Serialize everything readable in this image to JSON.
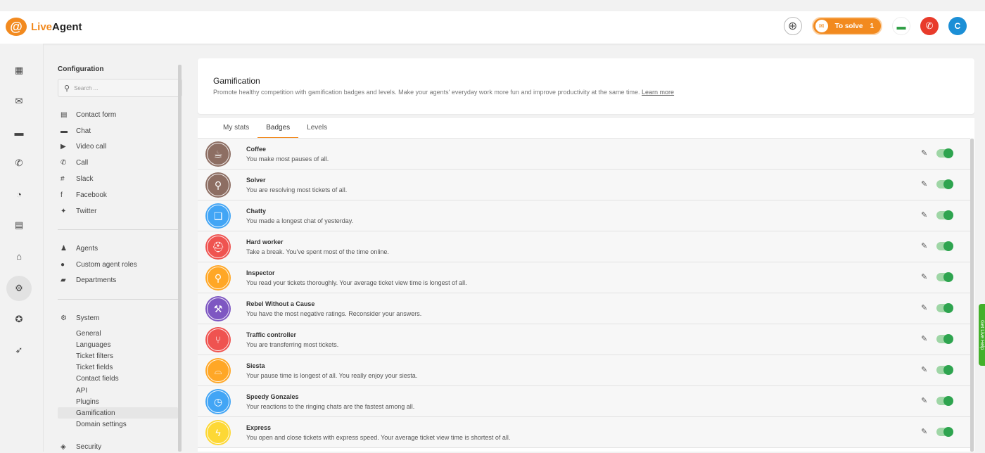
{
  "app": {
    "logo_glyph": "@",
    "logo_live": "Live",
    "logo_agent": "Agent"
  },
  "topbar": {
    "to_solve_label": "To solve",
    "to_solve_count": "1",
    "avatar_initial": "C",
    "colors": {
      "accent": "#f28a1f",
      "call": "#e83b2b",
      "avatar": "#1c8fd6",
      "chat": "#2e9e44"
    }
  },
  "leftnav": {
    "items": [
      {
        "icon": "dashboard-icon",
        "glyph": "▦"
      },
      {
        "icon": "mail-icon",
        "glyph": "✉"
      },
      {
        "icon": "chat-icon",
        "glyph": "▬"
      },
      {
        "icon": "phone-icon",
        "glyph": "✆"
      },
      {
        "icon": "reports-icon",
        "glyph": "◔"
      },
      {
        "icon": "contacts-icon",
        "glyph": "▤"
      },
      {
        "icon": "knowledgebase-icon",
        "glyph": "⌂"
      },
      {
        "icon": "settings-icon",
        "glyph": "⚙"
      },
      {
        "icon": "plugins-icon",
        "glyph": "✪"
      },
      {
        "icon": "rocket-icon",
        "glyph": "➶"
      }
    ]
  },
  "config": {
    "title": "Configuration",
    "search_placeholder": "Search ...",
    "channels": [
      {
        "label": "Contact form",
        "icon": "contact-form-icon",
        "glyph": "▤"
      },
      {
        "label": "Chat",
        "icon": "chat-icon",
        "glyph": "▬"
      },
      {
        "label": "Video call",
        "icon": "video-icon",
        "glyph": "▶"
      },
      {
        "label": "Call",
        "icon": "phone-icon",
        "glyph": "✆"
      },
      {
        "label": "Slack",
        "icon": "slack-icon",
        "glyph": "#"
      },
      {
        "label": "Facebook",
        "icon": "facebook-icon",
        "glyph": "f"
      },
      {
        "label": "Twitter",
        "icon": "twitter-icon",
        "glyph": "✦"
      }
    ],
    "agents": [
      {
        "label": "Agents",
        "icon": "agents-icon",
        "glyph": "♟"
      },
      {
        "label": "Custom agent roles",
        "icon": "person-icon",
        "glyph": "●"
      },
      {
        "label": "Departments",
        "icon": "folder-icon",
        "glyph": "▰"
      }
    ],
    "system": {
      "label": "System",
      "icon": "gear-icon",
      "glyph": "⚙"
    },
    "system_items": [
      "General",
      "Languages",
      "Ticket filters",
      "Ticket fields",
      "Contact fields",
      "API",
      "Plugins",
      "Gamification",
      "Domain settings"
    ],
    "active_item": "Gamification",
    "security": {
      "label": "Security",
      "icon": "shield-icon",
      "glyph": "◈"
    }
  },
  "header": {
    "title": "Gamification",
    "description": "Promote healthy competition with gamification badges and levels. Make your agents' everyday work more fun and improve productivity at the same time.",
    "learn_more": "Learn more"
  },
  "tabs": [
    {
      "label": "My stats",
      "active": false
    },
    {
      "label": "Badges",
      "active": true
    },
    {
      "label": "Levels",
      "active": false
    }
  ],
  "badges": [
    {
      "name": "Coffee",
      "desc": "You make most pauses of all.",
      "color": "#8d6e63",
      "icon": "coffee-icon",
      "glyph": "☕",
      "enabled": true
    },
    {
      "name": "Solver",
      "desc": "You are resolving most tickets of all.",
      "color": "#8d6e63",
      "icon": "broom-icon",
      "glyph": "⚲",
      "enabled": true
    },
    {
      "name": "Chatty",
      "desc": "You made a longest chat of yesterday.",
      "color": "#42a5f5",
      "icon": "chat-bubbles-icon",
      "glyph": "❏",
      "enabled": true
    },
    {
      "name": "Hard worker",
      "desc": "Take a break. You've spent most of the time online.",
      "color": "#ef5350",
      "icon": "helmet-icon",
      "glyph": "⛑",
      "enabled": true
    },
    {
      "name": "Inspector",
      "desc": "You read your tickets thoroughly. Your average ticket view time is longest of all.",
      "color": "#ffa726",
      "icon": "magnifier-icon",
      "glyph": "⚲",
      "enabled": true
    },
    {
      "name": "Rebel Without a Cause",
      "desc": "You have the most negative ratings. Reconsider your answers.",
      "color": "#7e57c2",
      "icon": "gavel-icon",
      "glyph": "⚒",
      "enabled": true
    },
    {
      "name": "Traffic controller",
      "desc": "You are transferring most tickets.",
      "color": "#ef5350",
      "icon": "split-arrows-icon",
      "glyph": "⑂",
      "enabled": true
    },
    {
      "name": "Siesta",
      "desc": "Your pause time is longest of all. You really enjoy your siesta.",
      "color": "#ffa726",
      "icon": "sombrero-icon",
      "glyph": "⌓",
      "enabled": true
    },
    {
      "name": "Speedy Gonzales",
      "desc": "Your reactions to the ringing chats are the fastest among all.",
      "color": "#42a5f5",
      "icon": "stopwatch-icon",
      "glyph": "◷",
      "enabled": true
    },
    {
      "name": "Express",
      "desc": "You open and close tickets with express speed. Your average ticket view time is shortest of all.",
      "color": "#fdd835",
      "icon": "lightning-icon",
      "glyph": "ϟ",
      "enabled": true
    }
  ],
  "help_tab": "Get Live Help"
}
